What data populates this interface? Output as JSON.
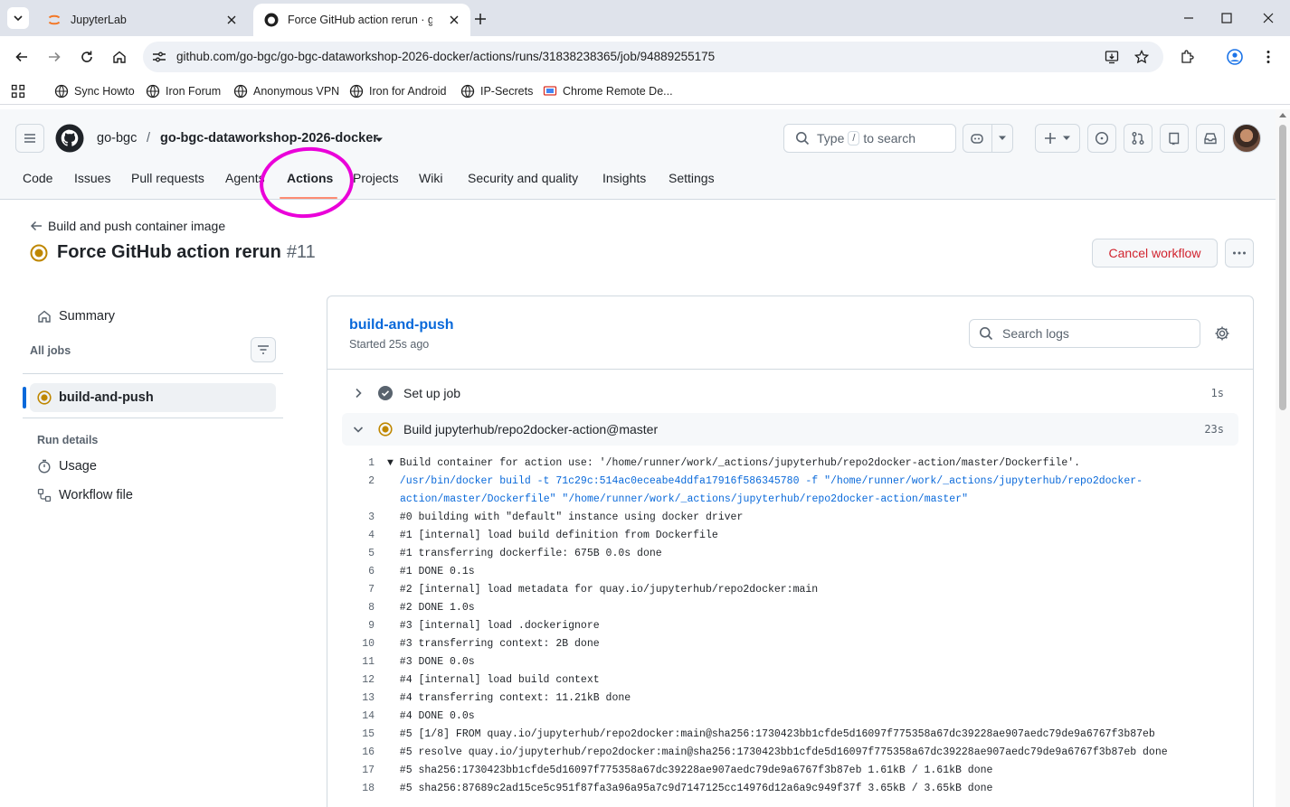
{
  "browser": {
    "tabs": [
      {
        "title": "JupyterLab",
        "active": false
      },
      {
        "title": "Force GitHub action rerun · go-bgc",
        "active": true
      }
    ],
    "url": "github.com/go-bgc/go-bgc-dataworkshop-2026-docker/actions/runs/31838238365/job/94889255175",
    "bookmarks": [
      "Sync Howto",
      "Iron Forum",
      "Anonymous VPN",
      "Iron for Android",
      "IP-Secrets",
      "Chrome Remote De..."
    ]
  },
  "header": {
    "owner": "go-bgc",
    "separator": "/",
    "repo": "go-bgc-dataworkshop-2026-docker",
    "search_prefix": "Type",
    "search_key": "/",
    "search_suffix": "to search"
  },
  "nav": {
    "tabs": [
      "Code",
      "Issues",
      "Pull requests",
      "Agents",
      "Actions",
      "Projects",
      "Wiki",
      "Security and quality",
      "Insights",
      "Settings"
    ],
    "active": "Actions"
  },
  "run": {
    "back_label": "Build and push container image",
    "title": "Force GitHub action rerun",
    "number": "#11",
    "cancel_label": "Cancel workflow"
  },
  "sidebar": {
    "summary": "Summary",
    "all_jobs": "All jobs",
    "job": "build-and-push",
    "run_details": "Run details",
    "usage": "Usage",
    "workflow_file": "Workflow file"
  },
  "job": {
    "name": "build-and-push",
    "started": "Started 25s ago",
    "search_placeholder": "Search logs",
    "steps": [
      {
        "name": "Set up job",
        "duration": "1s",
        "status": "success"
      },
      {
        "name": "Build jupyterhub/repo2docker-action@master",
        "duration": "23s",
        "status": "in_progress"
      }
    ],
    "log": [
      {
        "n": "1",
        "text": "▼ Build container for action use: '/home/runner/work/_actions/jupyterhub/repo2docker-action/master/Dockerfile'."
      },
      {
        "n": "2",
        "text": "  /usr/bin/docker build -t 71c29c:514ac0eceabe4ddfa17916f586345780 -f \"/home/runner/work/_actions/jupyterhub/repo2docker-",
        "cont": "action/master/Dockerfile\" \"/home/runner/work/_actions/jupyterhub/repo2docker-action/master\""
      },
      {
        "n": "3",
        "text": "  #0 building with \"default\" instance using docker driver"
      },
      {
        "n": "4",
        "text": "  #1 [internal] load build definition from Dockerfile"
      },
      {
        "n": "5",
        "text": "  #1 transferring dockerfile: 675B 0.0s done"
      },
      {
        "n": "6",
        "text": "  #1 DONE 0.1s"
      },
      {
        "n": "7",
        "text": "  #2 [internal] load metadata for quay.io/jupyterhub/repo2docker:main"
      },
      {
        "n": "8",
        "text": "  #2 DONE 1.0s"
      },
      {
        "n": "9",
        "text": "  #3 [internal] load .dockerignore"
      },
      {
        "n": "10",
        "text": "  #3 transferring context: 2B done"
      },
      {
        "n": "11",
        "text": "  #3 DONE 0.0s"
      },
      {
        "n": "12",
        "text": "  #4 [internal] load build context"
      },
      {
        "n": "13",
        "text": "  #4 transferring context: 11.21kB done"
      },
      {
        "n": "14",
        "text": "  #4 DONE 0.0s"
      },
      {
        "n": "15",
        "text": "  #5 [1/8] FROM quay.io/jupyterhub/repo2docker:main@sha256:1730423bb1cfde5d16097f775358a67dc39228ae907aedc79de9a6767f3b87eb"
      },
      {
        "n": "16",
        "text": "  #5 resolve quay.io/jupyterhub/repo2docker:main@sha256:1730423bb1cfde5d16097f775358a67dc39228ae907aedc79de9a6767f3b87eb done"
      },
      {
        "n": "17",
        "text": "  #5 sha256:1730423bb1cfde5d16097f775358a67dc39228ae907aedc79de9a6767f3b87eb 1.61kB / 1.61kB done"
      },
      {
        "n": "18",
        "text": "  #5 sha256:87689c2ad15ce5c951f87fa3a96a95a7c9d7147125cc14976d12a6a9c949f37f 3.65kB / 3.65kB done"
      }
    ]
  },
  "colors": {
    "accent": "#0969da",
    "danger": "#d1242f",
    "in_progress": "#bf8700",
    "annotation": "#ea00d9"
  }
}
